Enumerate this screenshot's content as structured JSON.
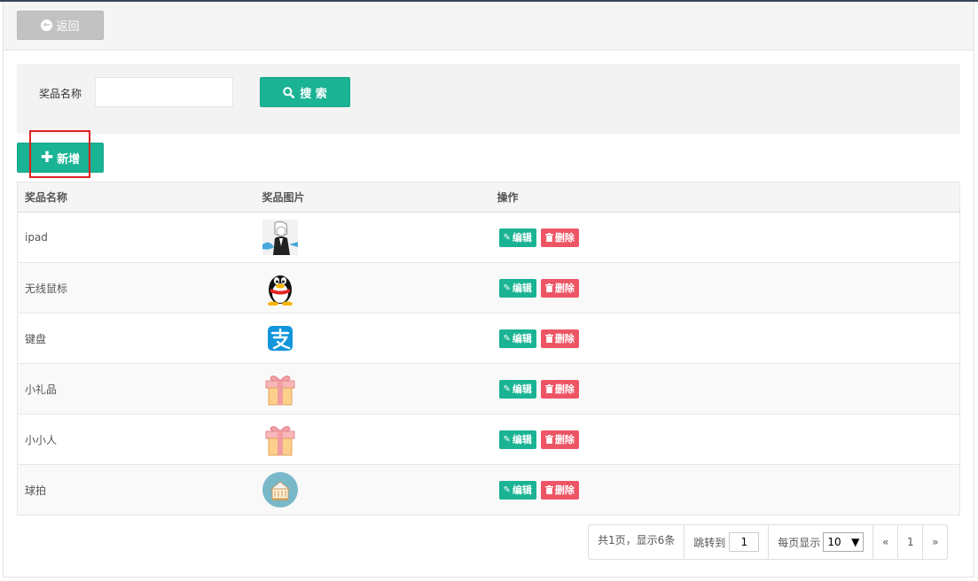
{
  "header": {
    "back_label": "返回"
  },
  "search": {
    "label": "奖品名称",
    "input_value": "",
    "button_label": "搜 索"
  },
  "toolbar": {
    "add_label": "新增"
  },
  "table": {
    "columns": [
      "奖品名称",
      "奖品图片",
      "操作"
    ],
    "edit_label": "编辑",
    "delete_label": "删除",
    "rows": [
      {
        "name": "ipad",
        "image": "anime-character-thumbnail"
      },
      {
        "name": "无线鼠标",
        "image": "qq-penguin-icon"
      },
      {
        "name": "键盘",
        "image": "alipay-icon"
      },
      {
        "name": "小礼品",
        "image": "gift-box-icon"
      },
      {
        "name": "小小人",
        "image": "gift-box-icon"
      },
      {
        "name": "球拍",
        "image": "shop-basket-icon"
      }
    ]
  },
  "pagination": {
    "summary": "共1页，显示6条",
    "jump_label": "跳转到",
    "jump_value": "1",
    "page_size_label": "每页显示",
    "page_size_value": "10",
    "prev": "«",
    "current_page": "1",
    "next": "»"
  },
  "colors": {
    "primary": "#1ab394",
    "danger": "#ed5565",
    "disabled": "#c2c2c2",
    "highlight": "#e02020"
  }
}
